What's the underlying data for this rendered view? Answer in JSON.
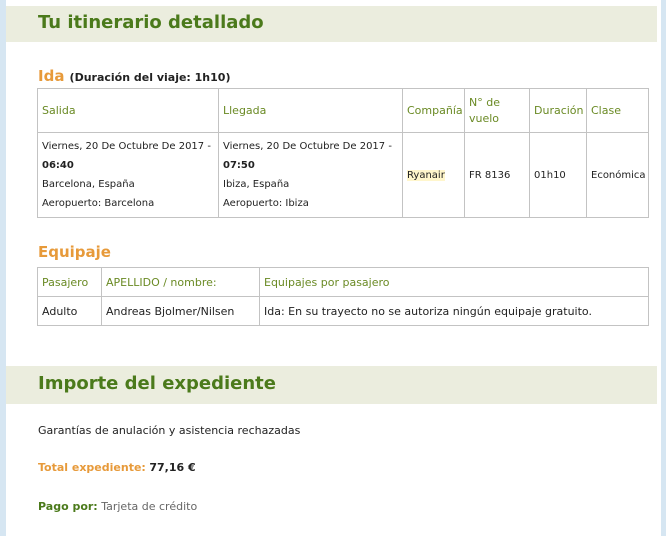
{
  "itinerary": {
    "title": "Tu itinerario detallado",
    "ida_label": "Ida",
    "ida_duration": "(Duración del viaje: 1h10)",
    "headers": {
      "salida": "Salida",
      "llegada": "Llegada",
      "compania": "Compañía",
      "vuelo": "N° de vuelo",
      "duracion": "Duración",
      "clase": "Clase"
    },
    "flight": {
      "salida_date": "Viernes, 20 De Octubre De 2017 -",
      "salida_time": "06:40",
      "salida_city": "Barcelona, España",
      "salida_airport": "Aeropuerto: Barcelona",
      "llegada_date": "Viernes, 20 De Octubre De 2017 -",
      "llegada_time": "07:50",
      "llegada_city": "Ibiza, España",
      "llegada_airport": "Aeropuerto: Ibiza",
      "compania": "Ryanair",
      "vuelo": "FR 8136",
      "duracion": "01h10",
      "clase": "Económica"
    }
  },
  "equipaje": {
    "title": "Equipaje",
    "headers": {
      "pasajero": "Pasajero",
      "apellido": "APELLIDO / nombre:",
      "equipajes": "Equipajes por pasajero"
    },
    "row": {
      "pasajero": "Adulto",
      "nombre": "Andreas Bjolmer/Nilsen",
      "equipaje": "Ida: En su trayecto no se autoriza ningún equipaje gratuito."
    }
  },
  "importe": {
    "title": "Importe del expediente",
    "guarantee": "Garantías de anulación y asistencia rechazadas",
    "total_label": "Total expediente:",
    "total_value": "77,16 €",
    "pago_label": "Pago por:",
    "pago_value": "Tarjeta de crédito"
  },
  "colors": {
    "heading_green": "#4b7a1b",
    "accent_orange": "#e79a3a",
    "band_bg": "#ebedde",
    "rail_blue": "#d6e6f2"
  }
}
